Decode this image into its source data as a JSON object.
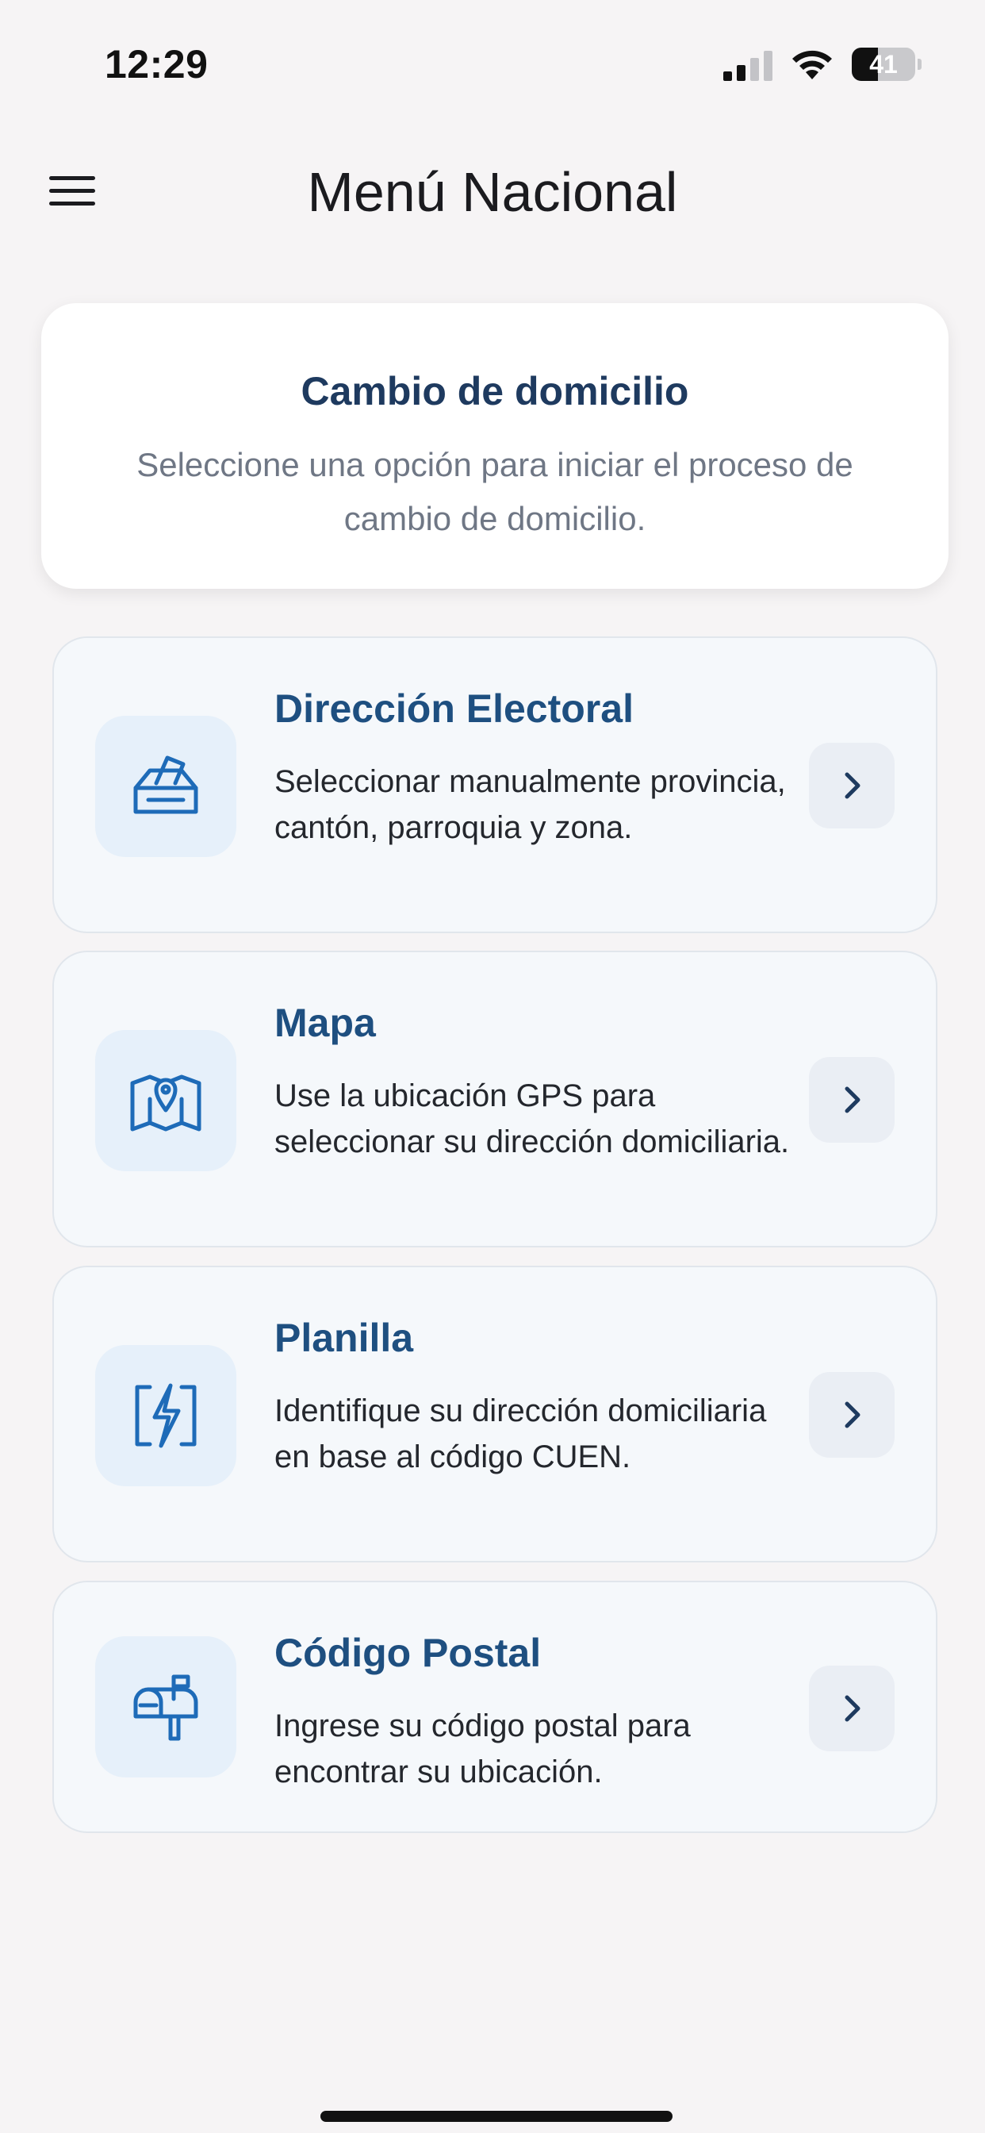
{
  "status_bar": {
    "time": "12:29",
    "battery_text": "41",
    "battery_level": 0.41
  },
  "header": {
    "title": "Menú Nacional"
  },
  "info_card": {
    "title": "Cambio de domicilio",
    "subtitle": "Seleccione una opción para iniciar el proceso de cambio de domicilio."
  },
  "options": [
    {
      "title": "Dirección Electoral",
      "description": "Seleccionar manualmente provincia, cantón, parroquia y zona.",
      "icon": "ballot-box-icon"
    },
    {
      "title": "Mapa",
      "description": "Use la ubicación GPS para seleccionar su dirección domiciliaria.",
      "icon": "map-pin-icon"
    },
    {
      "title": "Planilla",
      "description": "Identifique su dirección domiciliaria en base al código CUEN.",
      "icon": "electric-bill-icon"
    },
    {
      "title": "Código Postal",
      "description": "Ingrese su código postal para encontrar su ubicación.",
      "icon": "mailbox-icon"
    }
  ],
  "colors": {
    "accent": "#1e4f80",
    "info_title": "#1e3a5f",
    "icon_box": "#e6f0fa",
    "background": "#f6f4f5"
  }
}
